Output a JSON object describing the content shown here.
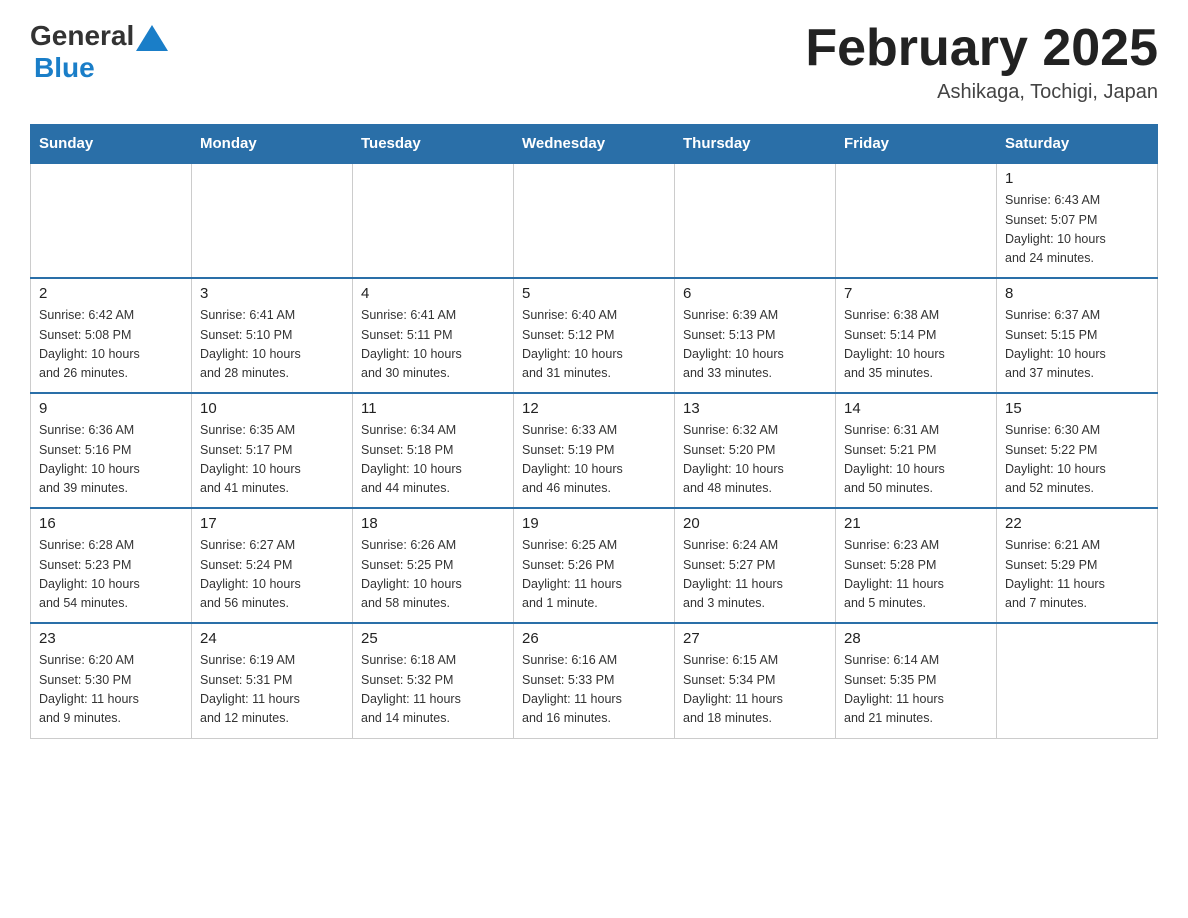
{
  "header": {
    "logo_general": "General",
    "logo_blue": "Blue",
    "month_year": "February 2025",
    "location": "Ashikaga, Tochigi, Japan"
  },
  "weekdays": [
    "Sunday",
    "Monday",
    "Tuesday",
    "Wednesday",
    "Thursday",
    "Friday",
    "Saturday"
  ],
  "weeks": [
    [
      {
        "day": "",
        "info": ""
      },
      {
        "day": "",
        "info": ""
      },
      {
        "day": "",
        "info": ""
      },
      {
        "day": "",
        "info": ""
      },
      {
        "day": "",
        "info": ""
      },
      {
        "day": "",
        "info": ""
      },
      {
        "day": "1",
        "info": "Sunrise: 6:43 AM\nSunset: 5:07 PM\nDaylight: 10 hours\nand 24 minutes."
      }
    ],
    [
      {
        "day": "2",
        "info": "Sunrise: 6:42 AM\nSunset: 5:08 PM\nDaylight: 10 hours\nand 26 minutes."
      },
      {
        "day": "3",
        "info": "Sunrise: 6:41 AM\nSunset: 5:10 PM\nDaylight: 10 hours\nand 28 minutes."
      },
      {
        "day": "4",
        "info": "Sunrise: 6:41 AM\nSunset: 5:11 PM\nDaylight: 10 hours\nand 30 minutes."
      },
      {
        "day": "5",
        "info": "Sunrise: 6:40 AM\nSunset: 5:12 PM\nDaylight: 10 hours\nand 31 minutes."
      },
      {
        "day": "6",
        "info": "Sunrise: 6:39 AM\nSunset: 5:13 PM\nDaylight: 10 hours\nand 33 minutes."
      },
      {
        "day": "7",
        "info": "Sunrise: 6:38 AM\nSunset: 5:14 PM\nDaylight: 10 hours\nand 35 minutes."
      },
      {
        "day": "8",
        "info": "Sunrise: 6:37 AM\nSunset: 5:15 PM\nDaylight: 10 hours\nand 37 minutes."
      }
    ],
    [
      {
        "day": "9",
        "info": "Sunrise: 6:36 AM\nSunset: 5:16 PM\nDaylight: 10 hours\nand 39 minutes."
      },
      {
        "day": "10",
        "info": "Sunrise: 6:35 AM\nSunset: 5:17 PM\nDaylight: 10 hours\nand 41 minutes."
      },
      {
        "day": "11",
        "info": "Sunrise: 6:34 AM\nSunset: 5:18 PM\nDaylight: 10 hours\nand 44 minutes."
      },
      {
        "day": "12",
        "info": "Sunrise: 6:33 AM\nSunset: 5:19 PM\nDaylight: 10 hours\nand 46 minutes."
      },
      {
        "day": "13",
        "info": "Sunrise: 6:32 AM\nSunset: 5:20 PM\nDaylight: 10 hours\nand 48 minutes."
      },
      {
        "day": "14",
        "info": "Sunrise: 6:31 AM\nSunset: 5:21 PM\nDaylight: 10 hours\nand 50 minutes."
      },
      {
        "day": "15",
        "info": "Sunrise: 6:30 AM\nSunset: 5:22 PM\nDaylight: 10 hours\nand 52 minutes."
      }
    ],
    [
      {
        "day": "16",
        "info": "Sunrise: 6:28 AM\nSunset: 5:23 PM\nDaylight: 10 hours\nand 54 minutes."
      },
      {
        "day": "17",
        "info": "Sunrise: 6:27 AM\nSunset: 5:24 PM\nDaylight: 10 hours\nand 56 minutes."
      },
      {
        "day": "18",
        "info": "Sunrise: 6:26 AM\nSunset: 5:25 PM\nDaylight: 10 hours\nand 58 minutes."
      },
      {
        "day": "19",
        "info": "Sunrise: 6:25 AM\nSunset: 5:26 PM\nDaylight: 11 hours\nand 1 minute."
      },
      {
        "day": "20",
        "info": "Sunrise: 6:24 AM\nSunset: 5:27 PM\nDaylight: 11 hours\nand 3 minutes."
      },
      {
        "day": "21",
        "info": "Sunrise: 6:23 AM\nSunset: 5:28 PM\nDaylight: 11 hours\nand 5 minutes."
      },
      {
        "day": "22",
        "info": "Sunrise: 6:21 AM\nSunset: 5:29 PM\nDaylight: 11 hours\nand 7 minutes."
      }
    ],
    [
      {
        "day": "23",
        "info": "Sunrise: 6:20 AM\nSunset: 5:30 PM\nDaylight: 11 hours\nand 9 minutes."
      },
      {
        "day": "24",
        "info": "Sunrise: 6:19 AM\nSunset: 5:31 PM\nDaylight: 11 hours\nand 12 minutes."
      },
      {
        "day": "25",
        "info": "Sunrise: 6:18 AM\nSunset: 5:32 PM\nDaylight: 11 hours\nand 14 minutes."
      },
      {
        "day": "26",
        "info": "Sunrise: 6:16 AM\nSunset: 5:33 PM\nDaylight: 11 hours\nand 16 minutes."
      },
      {
        "day": "27",
        "info": "Sunrise: 6:15 AM\nSunset: 5:34 PM\nDaylight: 11 hours\nand 18 minutes."
      },
      {
        "day": "28",
        "info": "Sunrise: 6:14 AM\nSunset: 5:35 PM\nDaylight: 11 hours\nand 21 minutes."
      },
      {
        "day": "",
        "info": ""
      }
    ]
  ]
}
